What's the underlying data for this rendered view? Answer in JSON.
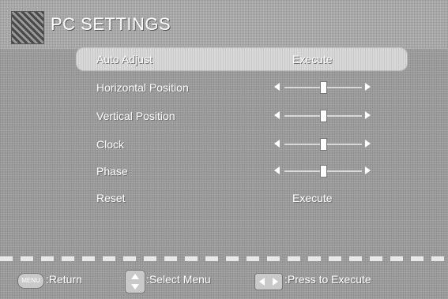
{
  "header": {
    "title": "PC SETTINGS",
    "icon": "pc-settings-icon"
  },
  "menu": {
    "items": [
      {
        "label": "Auto Adjust",
        "value": "Execute",
        "type": "action",
        "selected": true
      },
      {
        "label": "Horizontal Position",
        "type": "slider",
        "level": 0.5
      },
      {
        "label": "Vertical Position",
        "type": "slider",
        "level": 0.5
      },
      {
        "label": "Clock",
        "type": "slider",
        "level": 0.5
      },
      {
        "label": "Phase",
        "type": "slider",
        "level": 0.5
      },
      {
        "label": "Reset",
        "value": "Execute",
        "type": "action",
        "selected": false
      }
    ]
  },
  "footer": {
    "menu_key_text": "MENU",
    "return_label": ":Return",
    "select_label": ":Select Menu",
    "execute_label": ":Press to Execute"
  }
}
